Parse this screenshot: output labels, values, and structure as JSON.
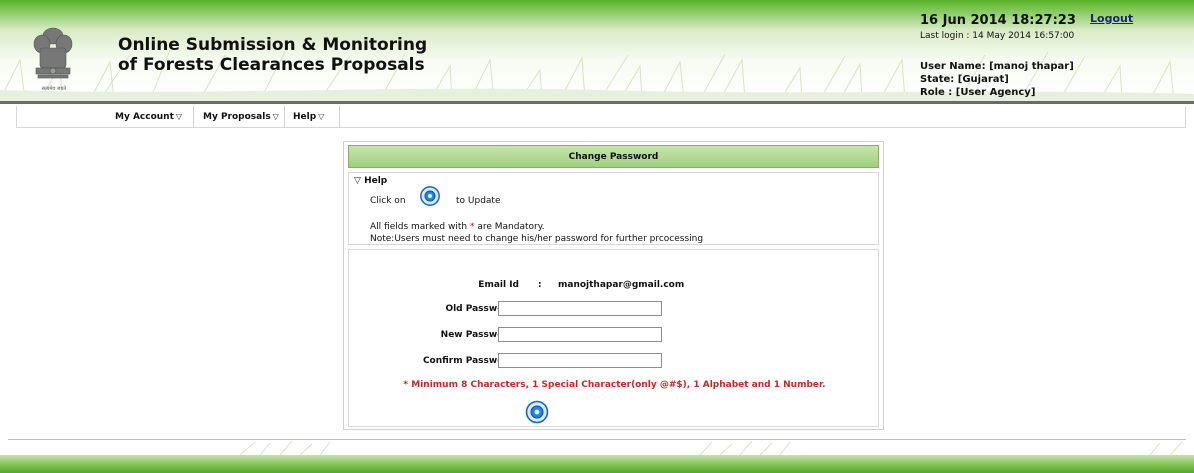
{
  "header": {
    "title_line1": "Online Submission & Monitoring",
    "title_line2": "of Forests Clearances Proposals",
    "emblem_caption": "सत्यमेव जयते",
    "datetime": "16 Jun 2014 18:27:23",
    "logout_label": "Logout",
    "last_login": "Last login : 14 May 2014 16:57:00",
    "user_name": "User Name: [manoj thapar]",
    "state": "State: [Gujarat]",
    "role": "Role : [User Agency]"
  },
  "menu": {
    "items": [
      {
        "label": "My Account"
      },
      {
        "label": "My Proposals"
      },
      {
        "label": "Help"
      }
    ]
  },
  "panel": {
    "title": "Change Password",
    "help": {
      "toggle_label": "Help",
      "click_on": "Click on",
      "to_update": "to Update",
      "mandatory_prefix": "All fields marked with",
      "mandatory_star": "*",
      "mandatory_suffix": "are Mandatory.",
      "note": "Note:Users must need to change his/her password for further prcocessing"
    },
    "form": {
      "email_label": "Email Id",
      "email_value": "manojthapar@gmail.com",
      "old_password_label": "Old Password",
      "new_password_label": "New Password",
      "confirm_password_label": "Confirm Password",
      "required_star": "*",
      "colon": ":",
      "old_password_value": "",
      "new_password_value": "",
      "confirm_password_value": "",
      "password_rule": "* Minimum 8 Characters, 1 Special Character(only @#$), 1 Alphabet and 1 Number."
    }
  },
  "colors": {
    "header_green": "#56b02a",
    "panel_header_green": "#9fd07e",
    "required_red": "#d00000",
    "rule_red": "#c62828",
    "logout_blue": "#1a237e",
    "icon_blue": "#1565c0"
  },
  "icons": {
    "update": "update-icon",
    "dropdown": "triangle-down-icon"
  }
}
